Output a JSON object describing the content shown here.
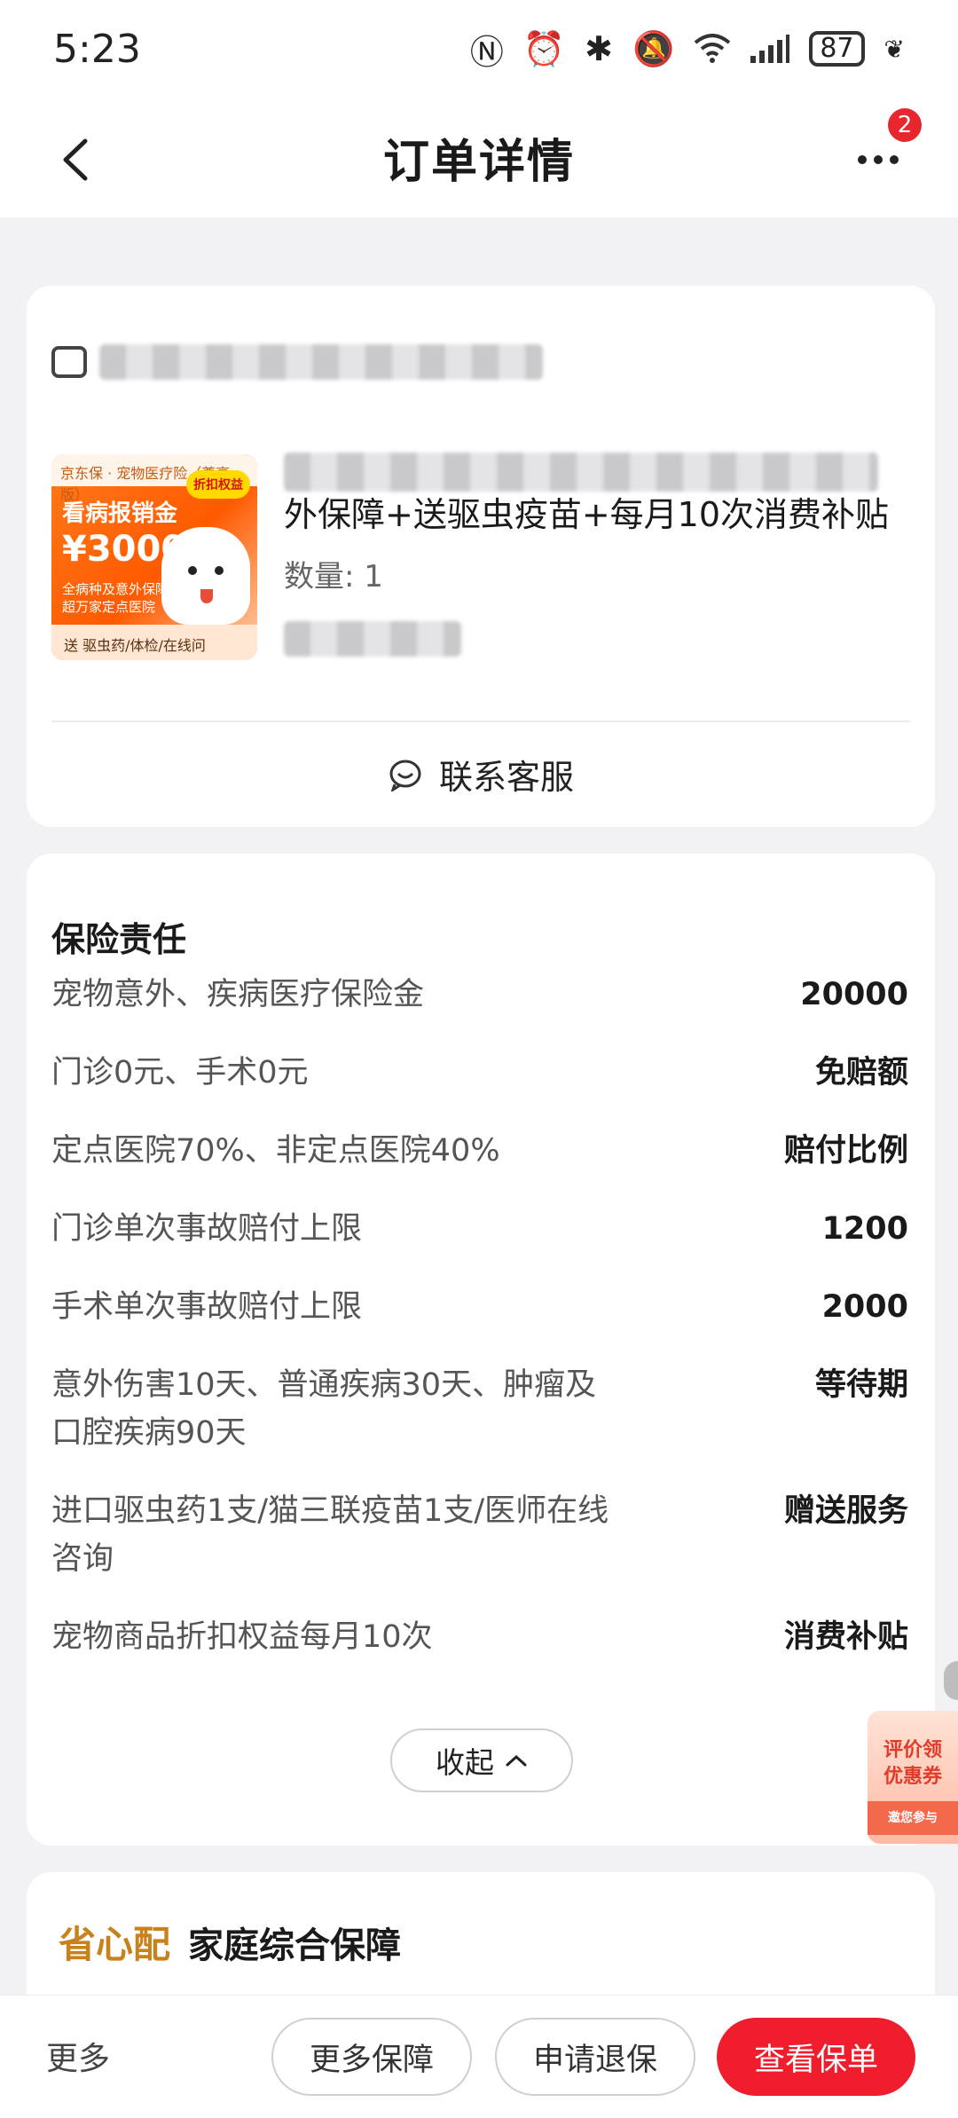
{
  "status_bar": {
    "time": "5:23",
    "battery": "87"
  },
  "header": {
    "title": "订单详情",
    "badge_count": "2"
  },
  "order": {
    "product_title_visible": "外保障+送驱虫疫苗+每月10次消费补贴",
    "quantity": "数量: 1",
    "thumb": {
      "top_text": "京东保 · 宠物医疗险（尊享版）",
      "tag": "折扣权益",
      "title": "看病报销金",
      "amount": "¥30000",
      "sub1": "全病种及意外保障",
      "sub2": "超万家定点医院",
      "bottom": "送 驱虫药/体检/在线问"
    },
    "contact_label": "联系客服"
  },
  "coverage": {
    "title": "保险责任",
    "rows": [
      {
        "label": "宠物意外、疾病医疗保险金",
        "value": "20000"
      },
      {
        "label": "门诊0元、手术0元",
        "value": "免赔额"
      },
      {
        "label": "定点医院70%、非定点医院40%",
        "value": "赔付比例"
      },
      {
        "label": "门诊单次事故赔付上限",
        "value": "1200"
      },
      {
        "label": "手术单次事故赔付上限",
        "value": "2000"
      },
      {
        "label": "意外伤害10天、普通疾病30天、肿瘤及口腔疾病90天",
        "value": "等待期"
      },
      {
        "label": "进口驱虫药1支/猫三联疫苗1支/医师在线咨询",
        "value": "赠送服务"
      },
      {
        "label": "宠物商品折扣权益每月10次",
        "value": "消费补贴"
      }
    ],
    "collapse_label": "收起"
  },
  "promo": {
    "line1": "评价领",
    "line2": "优惠券",
    "join": "邀您参与"
  },
  "family": {
    "brand": "省心配",
    "name": "家庭综合保障"
  },
  "bottom_bar": {
    "more": "更多",
    "btn_more_coverage": "更多保障",
    "btn_refund": "申请退保",
    "btn_view_policy": "查看保单"
  },
  "colors": {
    "primary_red": "#f01d2c",
    "brand_gold": "#c9821b",
    "badge_red": "#e8262d"
  }
}
